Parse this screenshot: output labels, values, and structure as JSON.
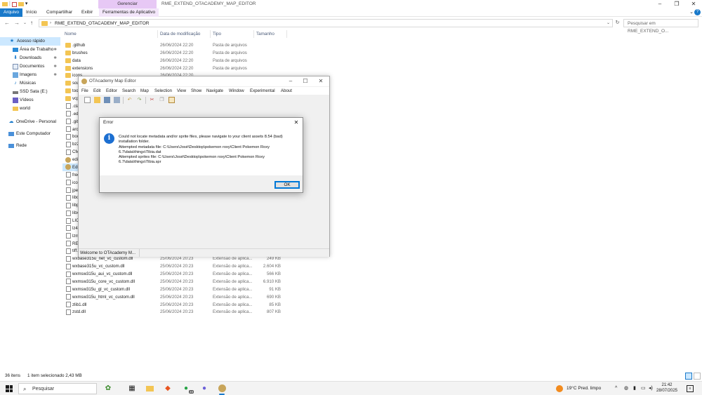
{
  "explorer": {
    "title": "RME_EXTEND_OTACADEMY_MAP_EDITOR",
    "context_tab_group": "Gerenciar",
    "ribbon_tabs": [
      "Arquivo",
      "Início",
      "Compartilhar",
      "Exibir",
      "Ferramentas de Aplicativo"
    ],
    "address_path": "RME_EXTEND_OTACADEMY_MAP_EDITOR",
    "search_placeholder": "Pesquisar em RME_EXTEND_O...",
    "nav": [
      {
        "label": "Acesso rápido",
        "icon": "star-icon"
      },
      {
        "label": "Área de Trabalho",
        "icon": "desktop-icon"
      },
      {
        "label": "Downloads",
        "icon": "download-icon"
      },
      {
        "label": "Documentos",
        "icon": "documents-icon"
      },
      {
        "label": "Imagens",
        "icon": "pictures-icon"
      },
      {
        "label": "Músicas",
        "icon": "music-icon"
      },
      {
        "label": "SSD Sata (E:)",
        "icon": "drive-icon"
      },
      {
        "label": "Vídeos",
        "icon": "video-icon"
      },
      {
        "label": "world",
        "icon": "folder-icon"
      },
      {
        "label": "OneDrive - Personal",
        "icon": "cloud-icon"
      },
      {
        "label": "Este Computador",
        "icon": "computer-icon"
      },
      {
        "label": "Rede",
        "icon": "network-icon"
      }
    ],
    "columns": {
      "name": "Nome",
      "date": "Data de modificação",
      "type": "Tipo",
      "size": "Tamanho"
    },
    "files": [
      {
        "name": ".github",
        "date": "26/06/2024 22:20",
        "type": "Pasta de arquivos",
        "size": "",
        "kind": "folder"
      },
      {
        "name": "brushes",
        "date": "26/06/2024 22:20",
        "type": "Pasta de arquivos",
        "size": "",
        "kind": "folder"
      },
      {
        "name": "data",
        "date": "26/06/2024 22:20",
        "type": "Pasta de arquivos",
        "size": "",
        "kind": "folder"
      },
      {
        "name": "extensions",
        "date": "26/06/2024 22:20",
        "type": "Pasta de arquivos",
        "size": "",
        "kind": "folder"
      },
      {
        "name": "icons",
        "date": "26/06/2024 22:20",
        "type": "",
        "size": "",
        "kind": "folder"
      },
      {
        "name": "sou",
        "date": "",
        "type": "",
        "size": "",
        "kind": "folder"
      },
      {
        "name": "too",
        "date": "",
        "type": "",
        "size": "",
        "kind": "folder"
      },
      {
        "name": "vcp",
        "date": "",
        "type": "",
        "size": "",
        "kind": "folder"
      },
      {
        "name": ".cla",
        "date": "",
        "type": "",
        "size": "",
        "kind": "file"
      },
      {
        "name": ".edi",
        "date": "",
        "type": "",
        "size": "",
        "kind": "file"
      },
      {
        "name": ".git",
        "date": "",
        "type": "",
        "size": "",
        "kind": "file"
      },
      {
        "name": "arch",
        "date": "",
        "type": "",
        "size": "",
        "kind": "file"
      },
      {
        "name": "boo",
        "date": "",
        "type": "",
        "size": "",
        "kind": "file"
      },
      {
        "name": "bz2",
        "date": "",
        "type": "",
        "size": "",
        "kind": "file"
      },
      {
        "name": "CM",
        "date": "",
        "type": "",
        "size": "",
        "kind": "file"
      },
      {
        "name": "edit",
        "date": "",
        "type": "",
        "size": "",
        "kind": "exe"
      },
      {
        "name": "Edit",
        "date": "",
        "type": "",
        "size": "",
        "kind": "exe"
      },
      {
        "name": "free",
        "date": "",
        "type": "",
        "size": "",
        "kind": "file"
      },
      {
        "name": "icon",
        "date": "",
        "type": "",
        "size": "",
        "kind": "file"
      },
      {
        "name": "jpeg",
        "date": "",
        "type": "",
        "size": "",
        "kind": "file"
      },
      {
        "name": "libc",
        "date": "",
        "type": "",
        "size": "",
        "kind": "file"
      },
      {
        "name": "libp",
        "date": "",
        "type": "",
        "size": "",
        "kind": "file"
      },
      {
        "name": "libx",
        "date": "",
        "type": "",
        "size": "",
        "kind": "file"
      },
      {
        "name": "LIC",
        "date": "",
        "type": "",
        "size": "",
        "kind": "file"
      },
      {
        "name": "lz4.",
        "date": "",
        "type": "",
        "size": "",
        "kind": "file"
      },
      {
        "name": "lzm",
        "date": "",
        "type": "",
        "size": "",
        "kind": "file"
      },
      {
        "name": "REA",
        "date": "",
        "type": "",
        "size": "",
        "kind": "file"
      },
      {
        "name": "tiff.",
        "date": "",
        "type": "",
        "size": "",
        "kind": "file"
      },
      {
        "name": "wxbase315u_net_vc_custom.dll",
        "date": "25/06/2024 20:23",
        "type": "Extensão de aplica...",
        "size": "249 KB",
        "kind": "file"
      },
      {
        "name": "wxbase315u_vc_custom.dll",
        "date": "25/06/2024 20:23",
        "type": "Extensão de aplica...",
        "size": "2.604 KB",
        "kind": "file"
      },
      {
        "name": "wxmsw315u_aui_vc_custom.dll",
        "date": "25/06/2024 20:23",
        "type": "Extensão de aplica...",
        "size": "566 KB",
        "kind": "file"
      },
      {
        "name": "wxmsw315u_core_vc_custom.dll",
        "date": "25/06/2024 20:23",
        "type": "Extensão de aplica...",
        "size": "6.910 KB",
        "kind": "file"
      },
      {
        "name": "wxmsw315u_gl_vc_custom.dll",
        "date": "25/06/2024 20:23",
        "type": "Extensão de aplica...",
        "size": "91 KB",
        "kind": "file"
      },
      {
        "name": "wxmsw315u_html_vc_custom.dll",
        "date": "25/06/2024 20:23",
        "type": "Extensão de aplica...",
        "size": "690 KB",
        "kind": "file"
      },
      {
        "name": "zlib1.dll",
        "date": "25/06/2024 20:23",
        "type": "Extensão de aplica...",
        "size": "85 KB",
        "kind": "file"
      },
      {
        "name": "zstd.dll",
        "date": "25/06/2024 20:23",
        "type": "Extensão de aplica...",
        "size": "807 KB",
        "kind": "file"
      }
    ],
    "status": {
      "count": "36 itens",
      "selection": "1 item selecionado  2,43 MB"
    }
  },
  "map_editor": {
    "title": "OTAcademy Map Editor",
    "menu": [
      "File",
      "Edit",
      "Editor",
      "Search",
      "Map",
      "Selection",
      "View",
      "Show",
      "Navigate",
      "Window",
      "Experimental",
      "About"
    ],
    "status_text": "Welcome to OTAcademy M..."
  },
  "error_dialog": {
    "title": "Error",
    "lines": [
      "Could not locate metadata and/or sprite files, please navigate to your client assets 8.54 (bad)",
      "installation folder.",
      "Attempted metadata file: C:\\Users\\José\\Desktop\\pokemon roxy\\Client Pokemon Roxy",
      "6.7\\data\\things\\Tibia.dat",
      "Attempted sprites file: C:\\Users\\José\\Desktop\\pokemon roxy\\Client Pokemon Roxy",
      "6.7\\data\\things\\Tibia.spr"
    ],
    "ok_label": "OK"
  },
  "taskbar": {
    "search_label": "Pesquisar",
    "whatsapp_badge": "48",
    "weather": "19°C  Pred. limpo",
    "time": "21:42",
    "date": "28/07/2025"
  },
  "colors": {
    "accent": "#1979ca",
    "folder": "#f3c553",
    "selection": "#cce8ff",
    "context_tab": "#e7c8f5"
  }
}
